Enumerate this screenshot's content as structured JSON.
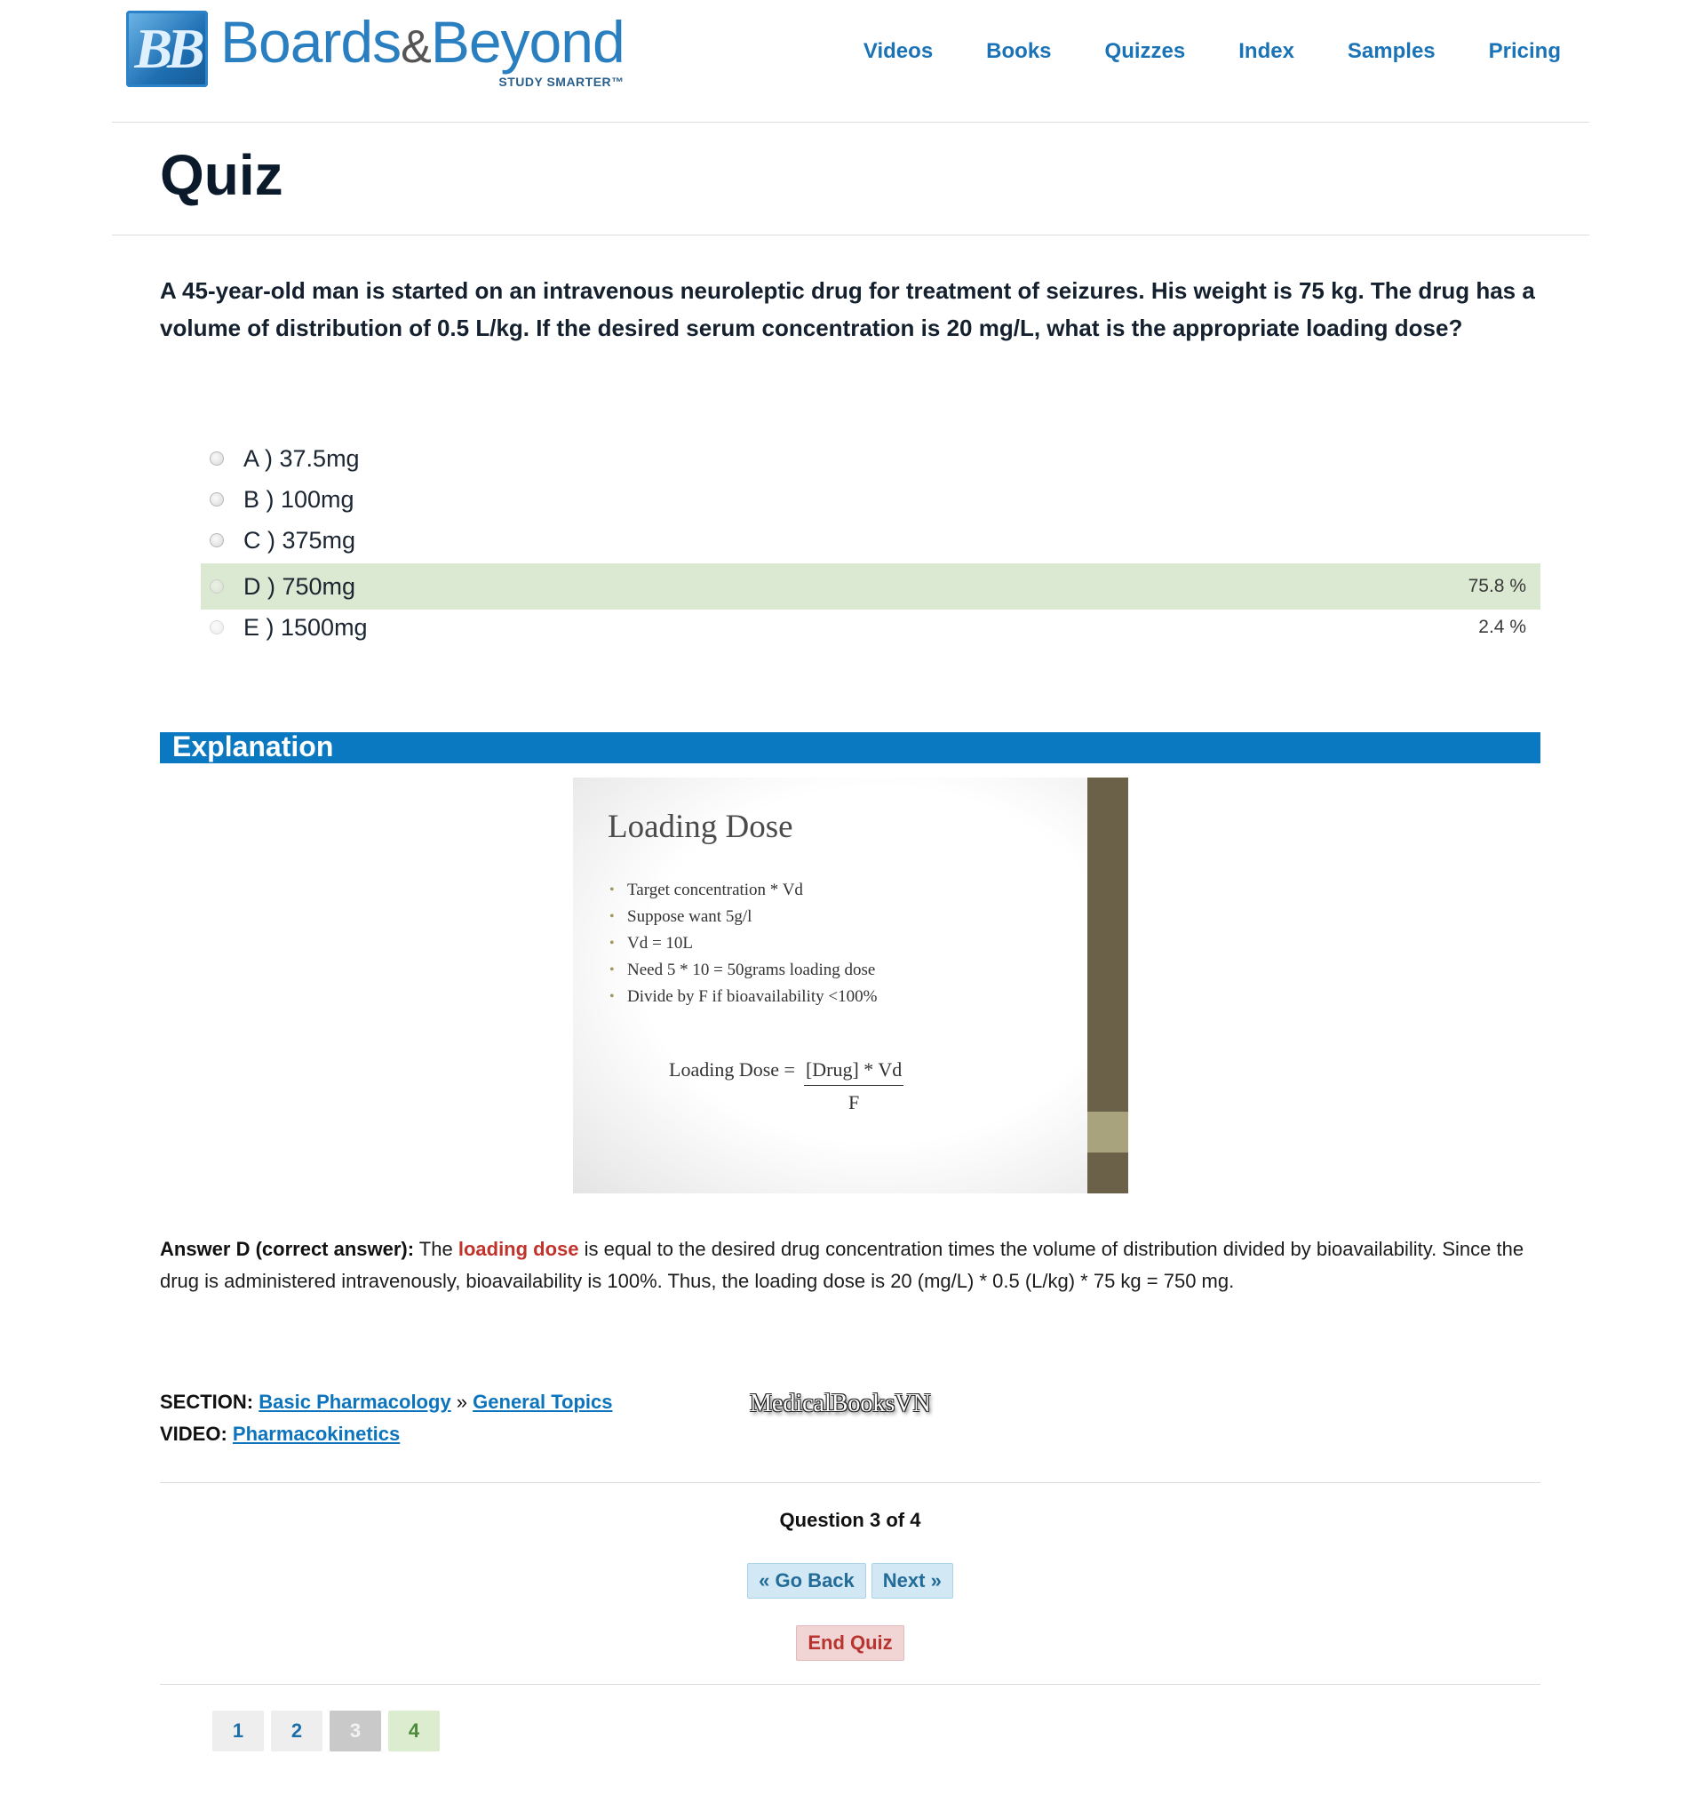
{
  "brand": {
    "logo_badge": "BB",
    "name_left": "Boards",
    "name_amp": "&",
    "name_right": "Beyond",
    "tagline": "STUDY SMARTER™"
  },
  "nav": [
    "Videos",
    "Books",
    "Quizzes",
    "Index",
    "Samples",
    "Pricing"
  ],
  "page_title": "Quiz",
  "question": "A 45-year-old man is started on an intravenous neuroleptic drug for treatment of seizures. His weight is 75 kg. The drug has a volume of distribution of 0.5 L/kg. If the desired serum concentration is 20 mg/L, what is the appropriate loading dose?",
  "options": [
    {
      "label": "A ) 37.5mg",
      "pct": ""
    },
    {
      "label": "B ) 100mg",
      "pct": ""
    },
    {
      "label": "C ) 375mg",
      "pct": ""
    },
    {
      "label": "D ) 750mg",
      "pct": "75.8 %",
      "correct": true
    },
    {
      "label": "E ) 1500mg",
      "pct": "2.4 %"
    }
  ],
  "explanation_heading": "Explanation",
  "slide": {
    "title": "Loading Dose",
    "bullets": [
      "Target concentration * Vd",
      "Suppose want 5g/l",
      "Vd = 10L",
      "Need 5 * 10 = 50grams loading dose",
      "Divide by F if bioavailability <100%"
    ],
    "formula_left": "Loading Dose  =",
    "formula_num": "[Drug] * Vd",
    "formula_den": "F"
  },
  "answer": {
    "lead": "Answer D (correct answer):",
    "pre": " The ",
    "highlight": "loading dose",
    "rest": " is equal to the desired drug concentration times the volume of distribution divided by bioavailability. Since the drug is administered intravenously, bioavailability is 100%. Thus, the loading dose is 20 (mg/L) * 0.5 (L/kg) * 75 kg = 750 mg."
  },
  "meta": {
    "section_label": "SECTION:",
    "section_link1": "Basic Pharmacology",
    "section_sep": " » ",
    "section_link2": "General Topics",
    "video_label": "VIDEO:",
    "video_link": "Pharmacokinetics"
  },
  "watermark": "MedicalBooksVN",
  "question_count": "Question 3 of 4",
  "buttons": {
    "back": "« Go Back",
    "next": "Next »",
    "end": "End Quiz"
  },
  "pages": [
    "1",
    "2",
    "3",
    "4"
  ],
  "colors": {
    "brand_blue": "#0b78c2",
    "correct_bg": "#dce9d2",
    "highlight_red": "#c0332c"
  }
}
